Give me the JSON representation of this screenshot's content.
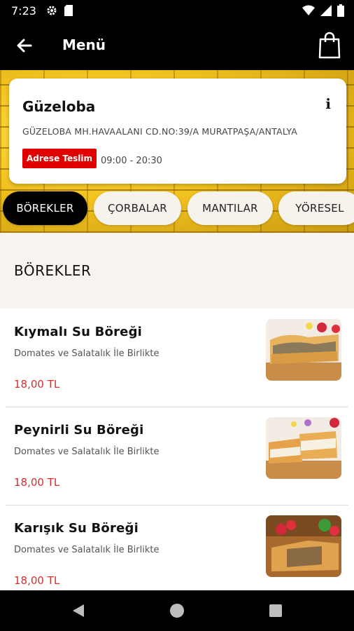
{
  "status": {
    "time": "7:23"
  },
  "appbar": {
    "title": "Menü"
  },
  "restaurant": {
    "name": "Güzeloba",
    "info": "i",
    "address": "GÜZELOBA MH.HAVAALANI CD.NO:39/A MURATPAŞA/ANTALYA",
    "badge": "Adrese Teslim",
    "hours": "09:00 - 20:30"
  },
  "categories": [
    {
      "label": "BÖREKLER",
      "active": true
    },
    {
      "label": "ÇORBALAR",
      "active": false
    },
    {
      "label": "MANTILAR",
      "active": false
    },
    {
      "label": "YÖRESEL",
      "active": false
    }
  ],
  "section": {
    "title": "BÖREKLER"
  },
  "items": [
    {
      "name": "Kıymalı Su Böreği",
      "desc": "Domates ve Salatalık İle Birlikte",
      "price": "18,00 TL"
    },
    {
      "name": "Peynirli Su Böreği",
      "desc": "Domates ve Salatalık İle Birlikte",
      "price": "18,00 TL"
    },
    {
      "name": "Karışık Su Böreği",
      "desc": "Domates ve Salatalık İle Birlikte",
      "price": "18,00 TL"
    }
  ],
  "colors": {
    "accent": "#e00000",
    "price": "#d32f2f",
    "bar": "#000000"
  }
}
